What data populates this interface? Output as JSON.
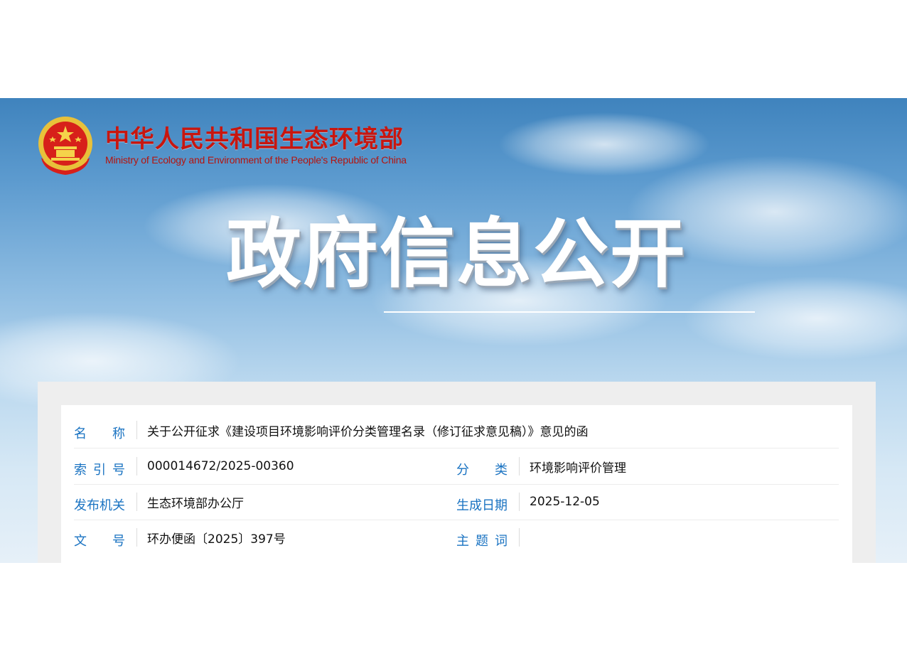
{
  "header": {
    "org_name_cn": "中华人民共和国生态环境部",
    "org_name_en": "Ministry of Ecology and Environment of the People's Republic of China",
    "banner_title": "政府信息公开"
  },
  "info": {
    "name_label": "名称",
    "name_value": "关于公开征求《建设项目环境影响评价分类管理名录（修订征求意见稿）》意见的函",
    "index_label": "索引号",
    "index_value": "000014672/2025-00360",
    "category_label": "分类",
    "category_value": "环境影响评价管理",
    "issuer_label": "发布机关",
    "issuer_value": "生态环境部办公厅",
    "date_label": "生成日期",
    "date_value": "2025-12-05",
    "docno_label": "文号",
    "docno_value": "环办便函〔2025〕397号",
    "keywords_label": "主题词",
    "keywords_value": ""
  },
  "colors": {
    "label_blue": "#1a73c2",
    "brand_red": "#c8160f",
    "panel_gray": "#eeeeee"
  },
  "icons": {
    "emblem": "national-emblem-icon"
  }
}
